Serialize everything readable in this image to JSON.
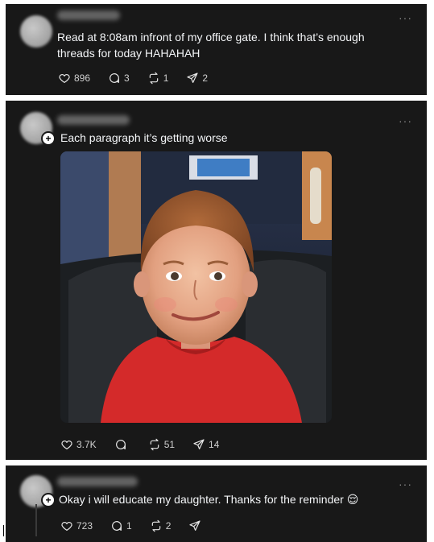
{
  "posts": [
    {
      "text": "Read at 8:08am infront of my office gate. I think that’s enough threads for today HAHAHAH",
      "likes": "896",
      "replies": "3",
      "reposts": "1",
      "shares": "2"
    },
    {
      "text": "Each paragraph it’s getting worse",
      "likes": "3.7K",
      "replies": "",
      "reposts": "51",
      "shares": "14",
      "image_icon": "photo-of-smiling-child"
    },
    {
      "text": "Okay i will educate my daughter. Thanks for the reminder",
      "emoji": "😌",
      "likes": "723",
      "replies": "1",
      "reposts": "2",
      "shares": ""
    }
  ],
  "icons": {
    "like": "heart-icon",
    "reply": "reply-bubble-icon",
    "repost": "repost-icon",
    "share": "send-icon",
    "more": "more-dots-icon"
  },
  "more_label": "···",
  "colors": {
    "card_bg": "#181818",
    "text": "#f3f5f7",
    "page_bg": "#ffffff"
  }
}
